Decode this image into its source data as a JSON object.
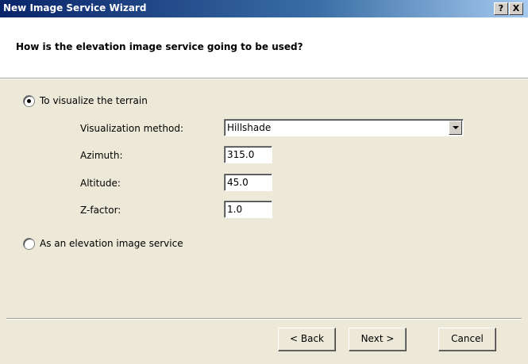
{
  "window": {
    "title": "New Image Service Wizard",
    "help_button": "?",
    "close_button": "X"
  },
  "header": {
    "question": "How is the elevation image service going to be used?"
  },
  "options": {
    "visualize": {
      "label": "To visualize the terrain",
      "checked": true
    },
    "elevation": {
      "label": "As an elevation image service",
      "checked": false
    }
  },
  "visualize_settings": {
    "method_label": "Visualization method:",
    "method_value": "Hillshade",
    "azimuth_label": "Azimuth:",
    "azimuth_value": "315.0",
    "altitude_label": "Altitude:",
    "altitude_value": "45.0",
    "zfactor_label": "Z-factor:",
    "zfactor_value": "1.0"
  },
  "footer": {
    "back_label": "< Back",
    "next_label": "Next >",
    "cancel_label": "Cancel"
  }
}
